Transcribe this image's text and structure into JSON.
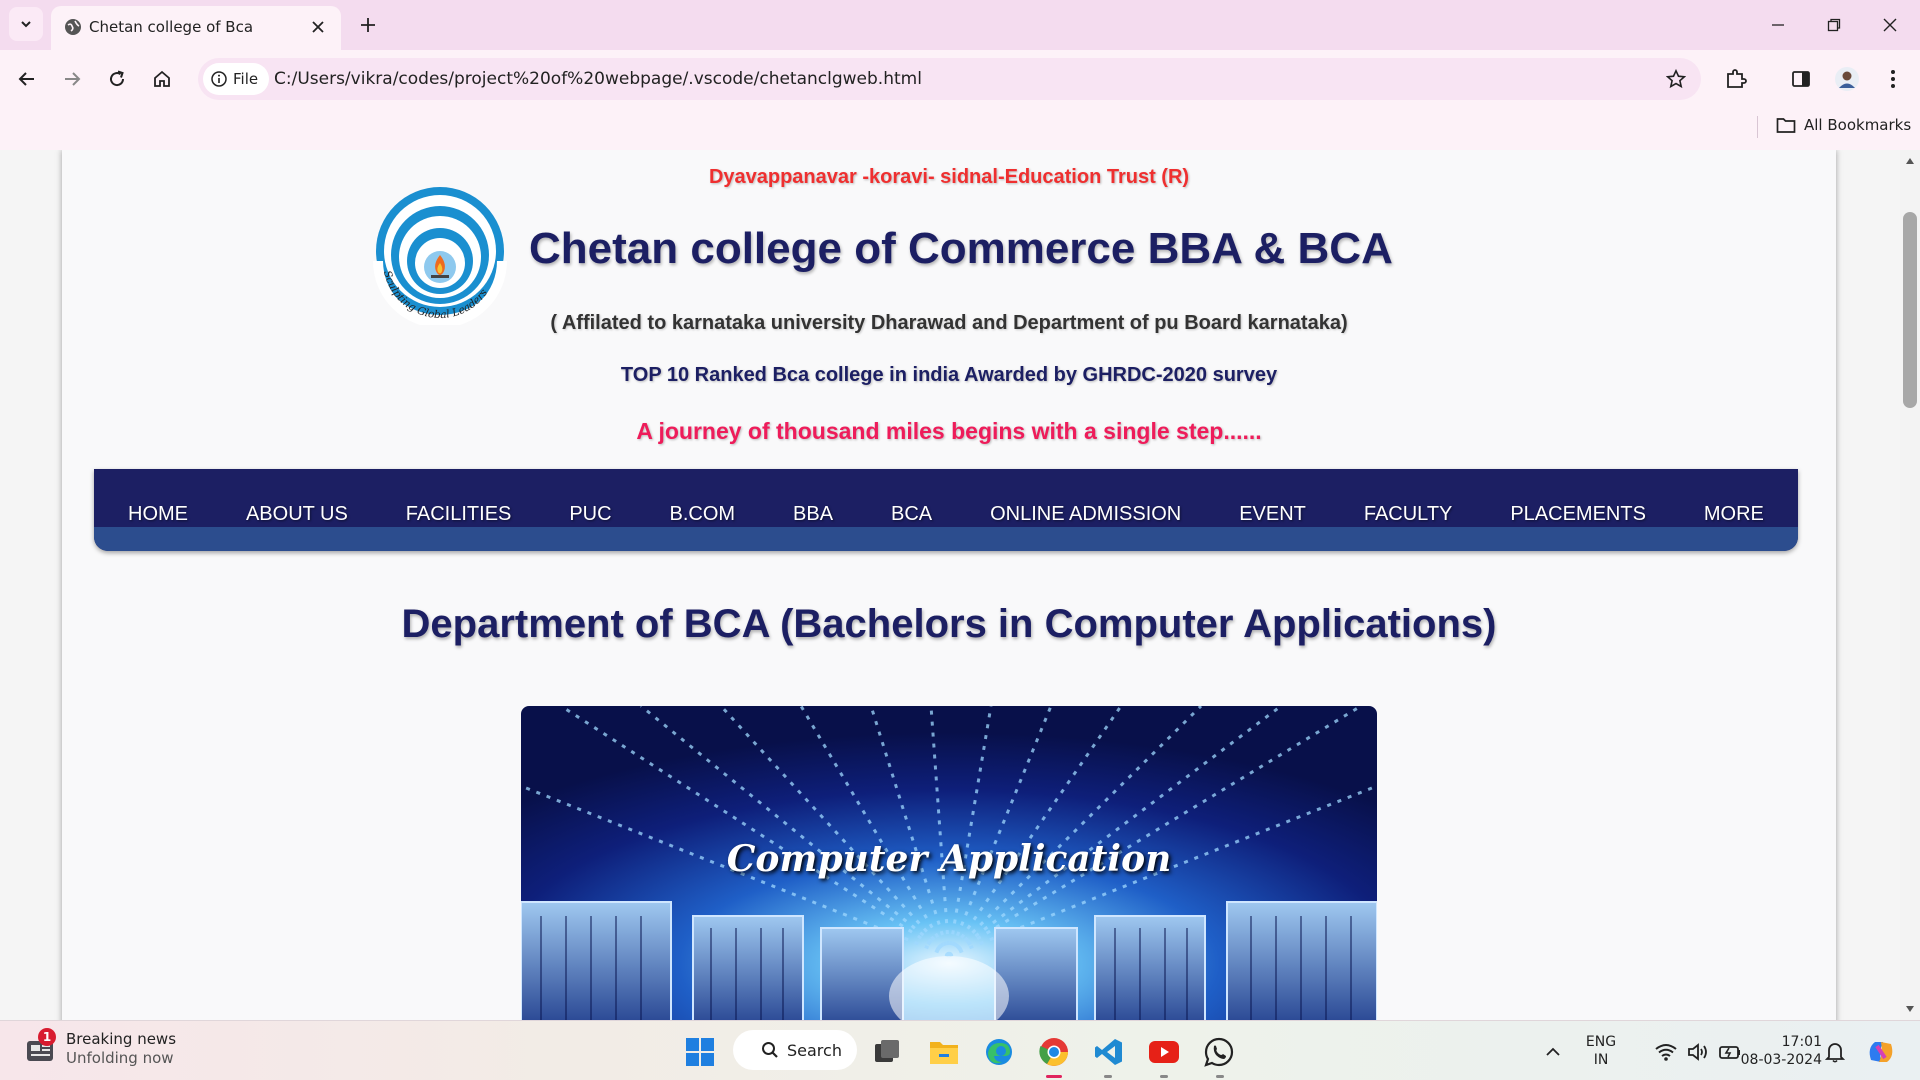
{
  "browser": {
    "tab_title": "Chetan college of Bca",
    "site_chip_label": "File",
    "url": "C:/Users/vikra/codes/project%20of%20webpage/.vscode/chetanclgweb.html",
    "bookmarks_label": "All Bookmarks"
  },
  "page": {
    "trust": "Dyavappanavar -koravi- sidnal-Education Trust (R)",
    "college_name": "Chetan college of Commerce BBA & BCA",
    "logo_text": "Sculpting Global Leaders",
    "affiliation": "( Affilated to karnataka university Dharawad and Department of pu Board karnataka)",
    "ranked": "TOP 10 Ranked Bca college in india Awarded by GHRDC-2020 survey",
    "quote": "A journey of thousand miles begins with a single step......",
    "nav": [
      "HOME",
      "ABOUT US",
      "FACILITIES",
      "PUC",
      "B.COM",
      "BBA",
      "BCA",
      "ONLINE ADMISSION",
      "EVENT",
      "FACULTY",
      "PLACEMENTS",
      "MORE"
    ],
    "dept_title": "Department of BCA (Bachelors in Computer Applications)",
    "hero_caption": "Computer Application"
  },
  "colors": {
    "navy": "#1c1f63",
    "nav_stripe": "#2c4d8e",
    "trust_red": "#ef2f2f",
    "quote_pink": "#ee1c5a"
  },
  "taskbar": {
    "news_badge": "1",
    "news_title": "Breaking news",
    "news_subtitle": "Unfolding now",
    "search_label": "Search",
    "lang_line1": "ENG",
    "lang_line2": "IN",
    "time": "17:01",
    "date": "08-03-2024",
    "apps": [
      "task-view",
      "file-explorer",
      "edge",
      "chrome",
      "vscode",
      "youtube",
      "whatsapp"
    ]
  }
}
